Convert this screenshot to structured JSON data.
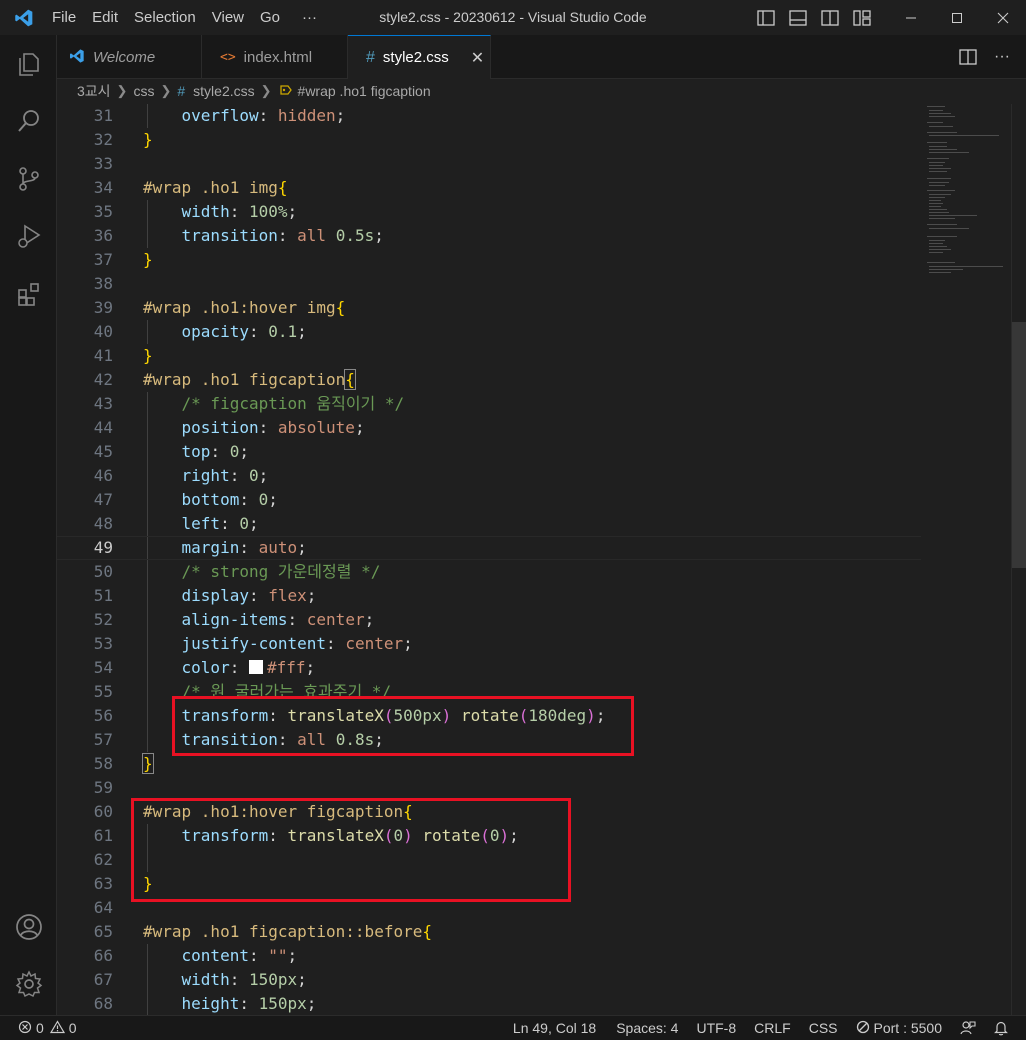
{
  "window": {
    "title": "style2.css - 20230612 - Visual Studio Code"
  },
  "menu": [
    "File",
    "Edit",
    "Selection",
    "View",
    "Go"
  ],
  "menu_more": "···",
  "colors": {
    "accent": "#0078d4",
    "highlight_box": "#e81123",
    "vscode_blue": "#3b9fe8"
  },
  "tabs": [
    {
      "label": "Welcome",
      "icon": "vscode-logo-icon",
      "active": false
    },
    {
      "label": "index.html",
      "icon": "html-file-icon",
      "active": false
    },
    {
      "label": "style2.css",
      "icon": "css-file-icon",
      "active": true
    }
  ],
  "breadcrumb": [
    "3교시",
    "css",
    "style2.css",
    "#wrap .ho1 figcaption"
  ],
  "editor": {
    "current_line": 49,
    "lines": [
      {
        "n": "31"
      },
      {
        "n": "32"
      },
      {
        "n": "33"
      },
      {
        "n": "34"
      },
      {
        "n": "35"
      },
      {
        "n": "36"
      },
      {
        "n": "37"
      },
      {
        "n": "38"
      },
      {
        "n": "39"
      },
      {
        "n": "40"
      },
      {
        "n": "41"
      },
      {
        "n": "42"
      },
      {
        "n": "43"
      },
      {
        "n": "44"
      },
      {
        "n": "45"
      },
      {
        "n": "46"
      },
      {
        "n": "47"
      },
      {
        "n": "48"
      },
      {
        "n": "49"
      },
      {
        "n": "50"
      },
      {
        "n": "51"
      },
      {
        "n": "52"
      },
      {
        "n": "53"
      },
      {
        "n": "54"
      },
      {
        "n": "55"
      },
      {
        "n": "56"
      },
      {
        "n": "57"
      },
      {
        "n": "58"
      },
      {
        "n": "59"
      },
      {
        "n": "60"
      },
      {
        "n": "61"
      },
      {
        "n": "62"
      },
      {
        "n": "63"
      },
      {
        "n": "64"
      },
      {
        "n": "65"
      },
      {
        "n": "66"
      },
      {
        "n": "67"
      },
      {
        "n": "68"
      }
    ],
    "code": {
      "l31": [
        "overflow",
        ":",
        " ",
        "hidden",
        ";"
      ],
      "l32": "}",
      "l34": [
        "#wrap .ho1 img",
        "{"
      ],
      "l35": [
        "width",
        ":",
        " ",
        "100%",
        ";"
      ],
      "l36": [
        "transition",
        ":",
        " ",
        "all",
        " ",
        "0.5s",
        ";"
      ],
      "l37": "}",
      "l39": [
        "#wrap .ho1:hover img",
        "{"
      ],
      "l40": [
        "opacity",
        ":",
        " ",
        "0.1",
        ";"
      ],
      "l41": "}",
      "l42": [
        "#wrap .ho1 figcaption",
        "{"
      ],
      "l43": "/* figcaption 움직이기 */",
      "l44": [
        "position",
        ":",
        " ",
        "absolute",
        ";"
      ],
      "l45": [
        "top",
        ":",
        " ",
        "0",
        ";"
      ],
      "l46": [
        "right",
        ":",
        " ",
        "0",
        ";"
      ],
      "l47": [
        "bottom",
        ":",
        " ",
        "0",
        ";"
      ],
      "l48": [
        "left",
        ":",
        " ",
        "0",
        ";"
      ],
      "l49": [
        "margin",
        ":",
        " ",
        "auto",
        ";"
      ],
      "l50": "/* strong 가운데정렬 */",
      "l51": [
        "display",
        ":",
        " ",
        "flex",
        ";"
      ],
      "l52": [
        "align-items",
        ":",
        " ",
        "center",
        ";"
      ],
      "l53": [
        "justify-content",
        ":",
        " ",
        "center",
        ";"
      ],
      "l54": [
        "color",
        ":",
        " ",
        "#fff",
        ";"
      ],
      "l55": "/* 원 굴러가는 효과주기 */",
      "l56": [
        "transform",
        ":",
        " ",
        "translateX",
        "(",
        "500px",
        ")",
        " ",
        "rotate",
        "(",
        "180deg",
        ")",
        ";"
      ],
      "l57": [
        "transition",
        ":",
        " ",
        "all",
        " ",
        "0.8s",
        ";"
      ],
      "l58": "}",
      "l60": [
        "#wrap .ho1:hover figcaption",
        "{"
      ],
      "l61": [
        "transform",
        ":",
        " ",
        "translateX",
        "(",
        "0",
        ")",
        " ",
        "rotate",
        "(",
        "0",
        ")",
        ";"
      ],
      "l63": "}",
      "l65": [
        "#wrap .ho1 figcaption::before",
        "{"
      ],
      "l66": [
        "content",
        ":",
        " ",
        "\"\"",
        ";"
      ],
      "l67": [
        "width",
        ":",
        " ",
        "150px",
        ";"
      ],
      "l68": [
        "height",
        ":",
        " ",
        "150px",
        ";"
      ]
    }
  },
  "status": {
    "errors": "0",
    "warnings": "0",
    "position": "Ln 49, Col 18",
    "spaces": "Spaces: 4",
    "encoding": "UTF-8",
    "eol": "CRLF",
    "language": "CSS",
    "port": "Port : 5500"
  }
}
